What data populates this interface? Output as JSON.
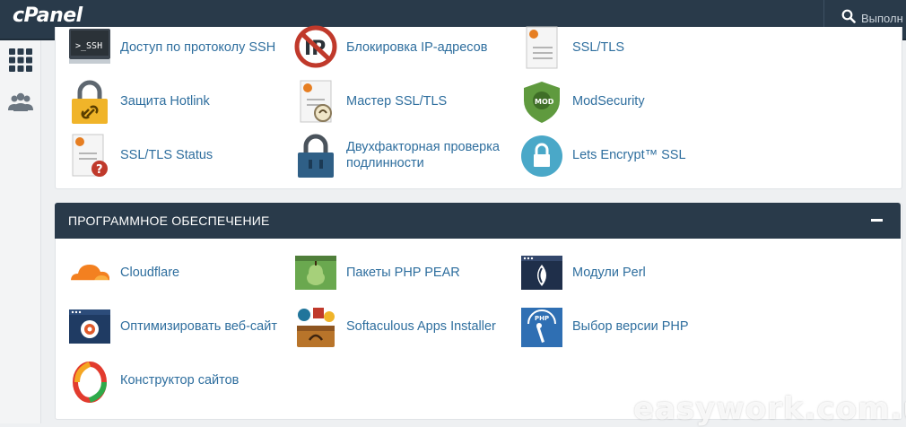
{
  "header": {
    "logo": "cPanel",
    "search_placeholder": "Выполн"
  },
  "security_items": [
    {
      "label": "Доступ по протоколу SSH",
      "icon": "ssh-terminal-icon"
    },
    {
      "label": "Блокировка IP-адресов",
      "icon": "ip-blocker-icon"
    },
    {
      "label": "SSL/TLS",
      "icon": "ssl-certificate-icon"
    },
    {
      "label": "Защита Hotlink",
      "icon": "hotlink-lock-icon"
    },
    {
      "label": "Мастер SSL/TLS",
      "icon": "ssl-wizard-icon"
    },
    {
      "label": "ModSecurity",
      "icon": "modsecurity-shield-icon"
    },
    {
      "label": "SSL/TLS Status",
      "icon": "ssl-status-icon"
    },
    {
      "label": "Двухфакторная проверка подлинности",
      "icon": "two-factor-lock-icon"
    },
    {
      "label": "Lets Encrypt™ SSL",
      "icon": "lets-encrypt-icon"
    }
  ],
  "software_section": {
    "title": "ПРОГРАММНОЕ ОБЕСПЕЧЕНИЕ",
    "items": [
      {
        "label": "Cloudflare",
        "icon": "cloudflare-icon"
      },
      {
        "label": "Пакеты PHP PEAR",
        "icon": "php-pear-icon"
      },
      {
        "label": "Модули Perl",
        "icon": "perl-modules-icon"
      },
      {
        "label": "Оптимизировать веб-сайт",
        "icon": "optimize-website-icon"
      },
      {
        "label": "Softaculous Apps Installer",
        "icon": "softaculous-icon"
      },
      {
        "label": "Выбор версии PHP",
        "icon": "php-version-icon"
      },
      {
        "label": "Конструктор сайтов",
        "icon": "site-builder-icon"
      }
    ]
  },
  "watermark": "easywork.com.ua"
}
